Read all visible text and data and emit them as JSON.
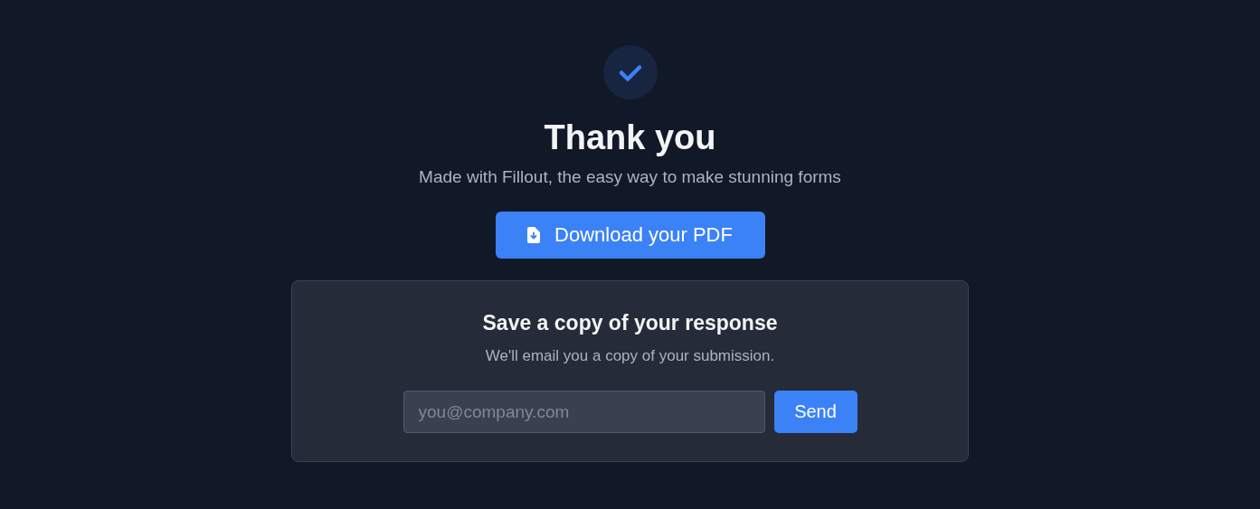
{
  "title": "Thank you",
  "subtitle": "Made with Fillout, the easy way to make stunning forms",
  "download_button": "Download your PDF",
  "save_card": {
    "heading": "Save a copy of your response",
    "text": "We'll email you a copy of your submission.",
    "email": {
      "placeholder": "you@company.com"
    },
    "button": "Send"
  }
}
